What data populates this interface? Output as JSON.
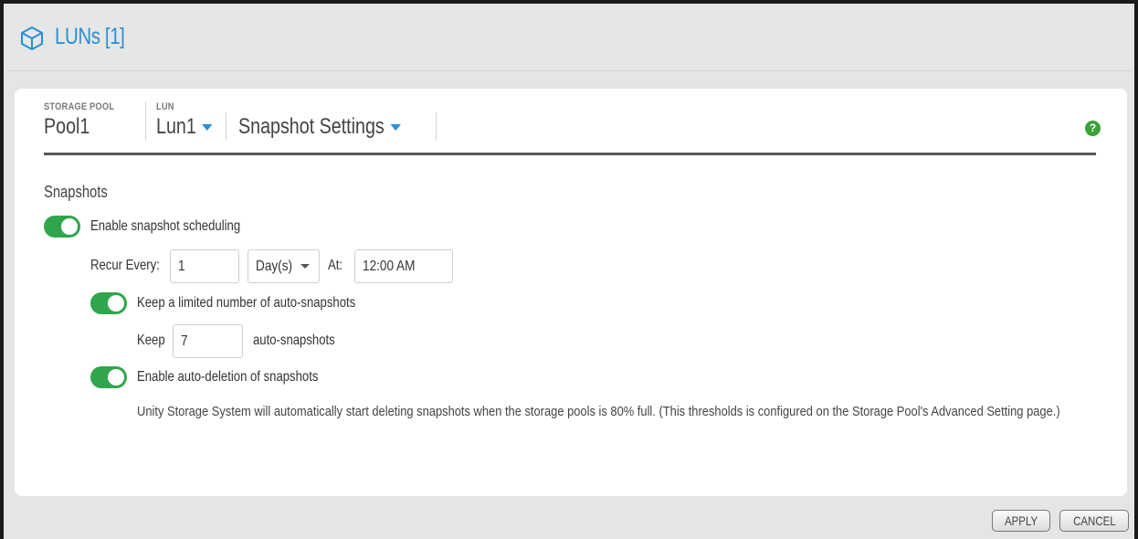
{
  "header": {
    "title": "LUNs [1]",
    "icon": "cube-icon"
  },
  "breadcrumb": {
    "pool_label": "STORAGE POOL",
    "pool_value": "Pool1",
    "lun_label": "LUN",
    "lun_value": "Lun1",
    "view_value": "Snapshot Settings"
  },
  "section": {
    "title": "Snapshots"
  },
  "schedule": {
    "enable_label": "Enable snapshot scheduling",
    "enabled": true,
    "recur_label": "Recur Every:",
    "recur_value": "1",
    "unit_value": "Day(s)",
    "at_label": "At:",
    "time_value": "12:00 AM"
  },
  "limit": {
    "label": "Keep a limited number of auto-snapshots",
    "enabled": true,
    "keep_label": "Keep",
    "keep_value": "7",
    "suffix": "auto-snapshots"
  },
  "autodelete": {
    "label": "Enable auto-deletion of snapshots",
    "enabled": true,
    "description": "Unity Storage System will automatically start deleting snapshots when the storage pools is 80% full. (This thresholds is configured on the Storage Pool's Advanced Setting page.)"
  },
  "footer": {
    "apply_label": "APPLY",
    "cancel_label": "CANCEL"
  },
  "colors": {
    "accent": "#2a8fd4",
    "toggle_on": "#2fa64b",
    "help": "#3aa33a"
  }
}
